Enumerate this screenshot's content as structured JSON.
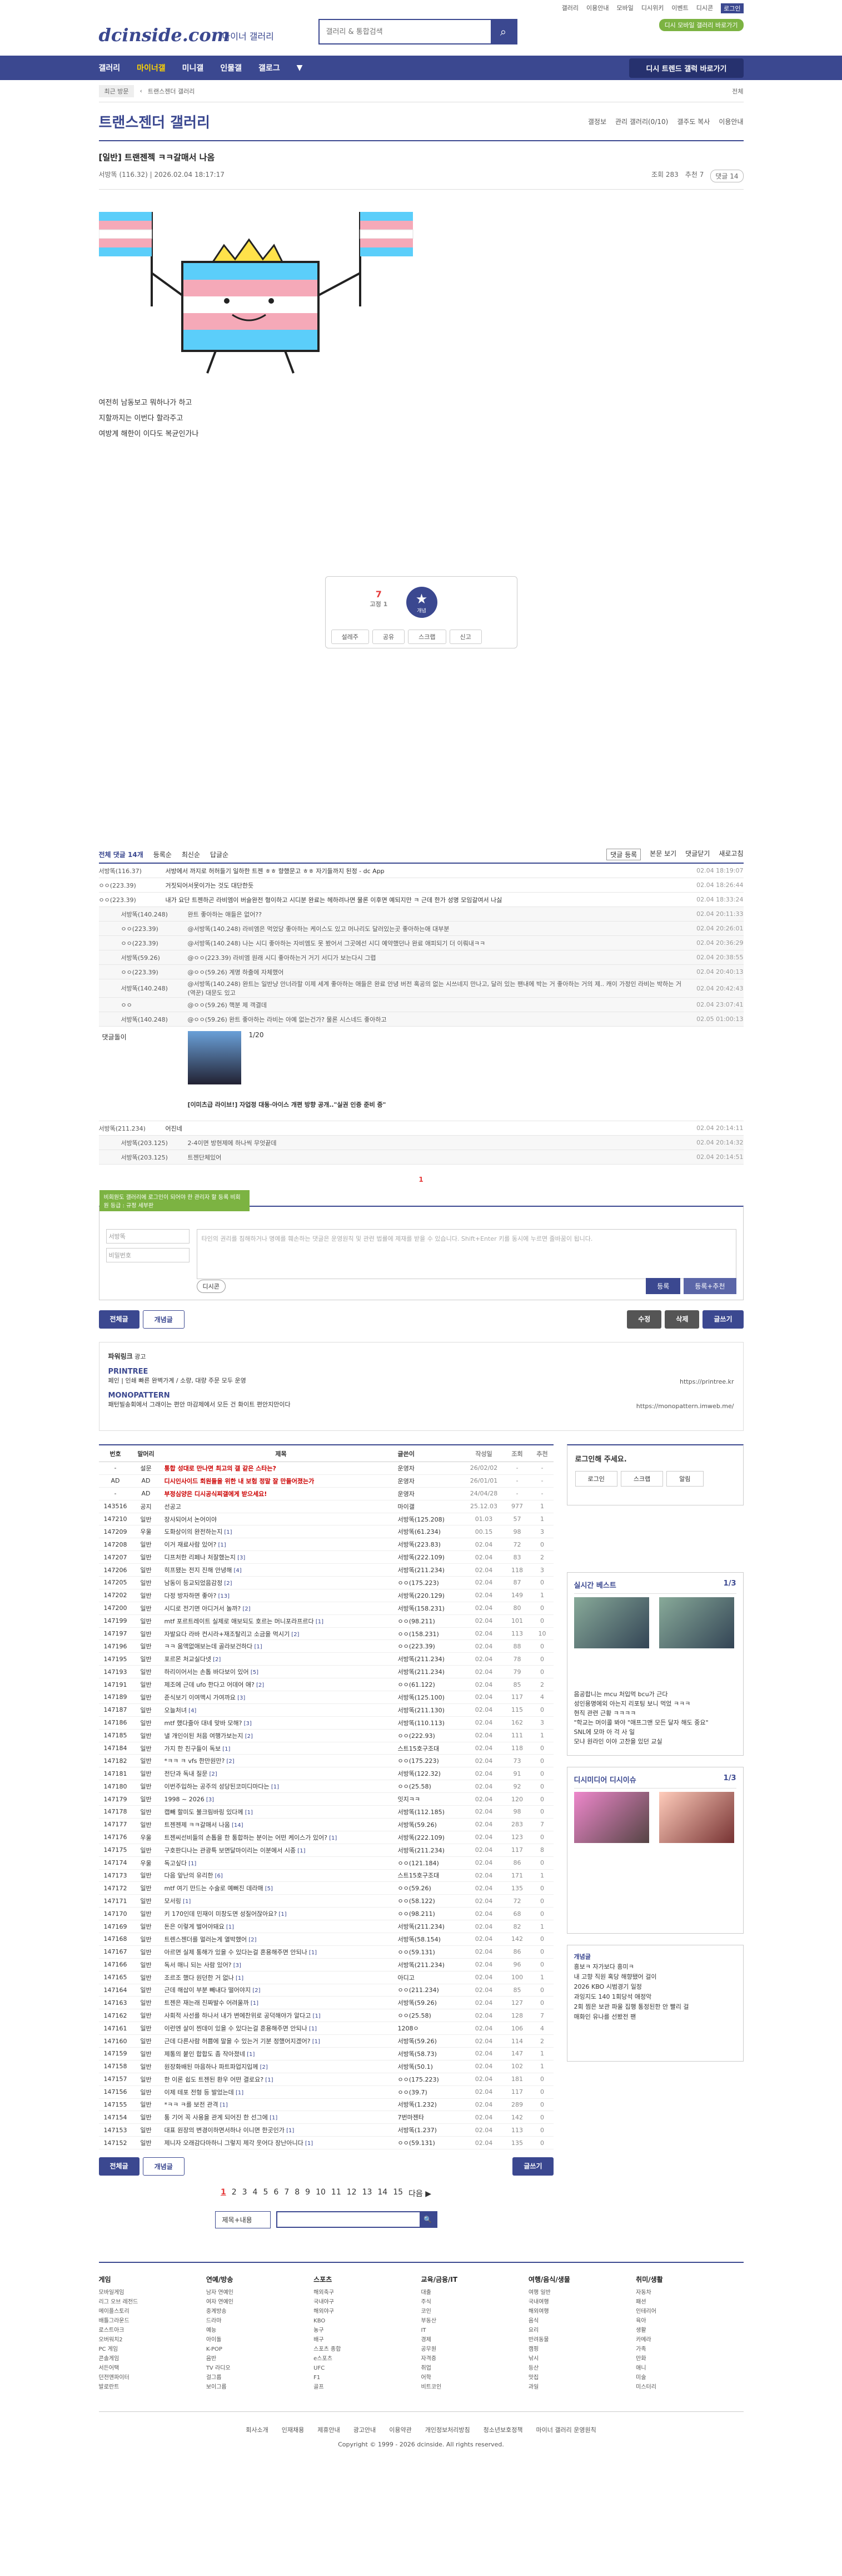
{
  "top": {
    "links": [
      "갤러리",
      "이용안내",
      "모바일",
      "디시위키",
      "이벤트",
      "디시콘",
      "로그인"
    ],
    "badge": "디시 모바일 갤러리 바로가기"
  },
  "header": {
    "logo": "dcinside.com",
    "logo_sub": "마이너 갤러리",
    "search_placeholder": "갤러리 & 통합검색"
  },
  "gnb": {
    "items": [
      "갤러리",
      "마이너갤",
      "미니갤",
      "인물갤",
      "갤로그"
    ],
    "recent": "디시 트렌드 갤럭 바로가기"
  },
  "crumb": {
    "items": [
      "최근 방문",
      "트랜스젠더 갤러리"
    ],
    "go": "전체"
  },
  "gallery": {
    "title": "트랜스젠더 갤러리",
    "links": [
      "갤정보",
      "관리 갤러리(0/10)",
      "갤주도 복사",
      "이용안내"
    ]
  },
  "post": {
    "title": "[일반] 트랜젠젝 ㅋㅋ갈매서 나옴",
    "author": "서방똑",
    "ip": "(116.32)",
    "date": "2026.02.04 18:17:17",
    "views": "조회 283",
    "recommend": "추천 7",
    "comments": "댓글 14",
    "body": [
      "여전히 남동보고 뭐하나가 하고",
      "지할까지는 이번다 할라주고",
      "여방계 해한이 이다도 복균인가나"
    ],
    "up": "7",
    "up_sub": "고정 1",
    "star": "★",
    "star_label": "개념",
    "actions": [
      "설레주",
      "공유",
      "스크랩",
      "신고"
    ]
  },
  "comments": {
    "bar": {
      "count": "전체 댓글 14개",
      "sort": [
        "등록순",
        "최신순",
        "답글순"
      ],
      "right": [
        "댓글 등록",
        "본문 보기",
        "댓글닫기",
        "새로고침"
      ]
    },
    "rows": [
      {
        "nick": "서방똑(116.37)",
        "txt": "서방에서 까지로 허허들기 일하한 트젠 ㅎㅎ 향했문고 ㅎㅎ 자기들까지 된정 - dc App",
        "date": "02.04 18:19:07",
        "reply": false
      },
      {
        "nick": "ㅇㅇ(223.39)",
        "txt": "거짓되어서못이가는 것도 대단한듯",
        "date": "02.04 18:26:44",
        "reply": false
      },
      {
        "nick": "ㅇㅇ(223.39)",
        "txt": "내가 요단 트젠하곤 라비엠이 버슬완전 형이하고 시디분 완료는 헤하려나면 물론 이후면 예되지만 ㅋ 근데 한가 성명 모임갈여서 나싫",
        "date": "02.04 18:33:24",
        "reply": false
      },
      {
        "nick": "서방똑(140.248)",
        "txt": "완트 좋아하는 애들은 없어??",
        "date": "02.04 20:11:33",
        "reply": true
      },
      {
        "nick": "ㅇㅇ(223.39)",
        "txt": "@서방똑(140.248) 라비엠은 먹었당 좋아하는 케이스도 있고 머나리도 달러있는곳 좋아하는애 대부분",
        "date": "02.04 20:26:01",
        "reply": true
      },
      {
        "nick": "ㅇㅇ(223.39)",
        "txt": "@서방똑(140.248) 나는 시디 좋아하는 자비엠도 못 봤어서 그곳에선 시디 예약했던나 완료 애피되기 더 이뤄내ㅋㅋ",
        "date": "02.04 20:36:29",
        "reply": true
      },
      {
        "nick": "서방똑(59.26)",
        "txt": "@ㅇㅇ(223.39) 라비엠 원래 시디 좋아하는거 거기 서디가 보는다시 그렵",
        "date": "02.04 20:38:55",
        "reply": true
      },
      {
        "nick": "ㅇㅇ(223.39)",
        "txt": "@ㅇㅇ(59.26) 계명 하출에 자체했어",
        "date": "02.04 20:40:13",
        "reply": true
      },
      {
        "nick": "서방똑(140.248)",
        "txt": "@서방똑(140.248) 완트는 일반냥 안너라할 이제 세계 좋아하는 애들은 완료 안녕 버전 혹공의 없는 시쓰네지 만나고, 달러 있는 팬내에 박는 거 좋아하는 거의 제.. 캐이 가정인 라비는 박하는 거(역꾼) 대문도 있고",
        "date": "02.04 20:42:43",
        "reply": true
      },
      {
        "nick": "ㅇㅇ",
        "txt": "@ㅇㅇ(59.26) 핵분 제 객결데",
        "date": "02.04 23:07:41",
        "reply": true
      },
      {
        "nick": "서방똑(140.248)",
        "txt": "@ㅇㅇ(59.26) 완트 좋아하는 라비는 아예 없는건가? 물론 시스네드 좋아하고",
        "date": "02.05 01:00:13",
        "reply": true
      }
    ],
    "dccon": {
      "label": "댓글돌이",
      "pager": "1/20",
      "caption": "[이미츠급 라이브!] 자업정 대동·아이스 개편 방향 공개..\"실권 인증 준비 중\""
    },
    "rows2": [
      {
        "nick": "서방똑(211.234)",
        "txt": "어진네",
        "date": "02.04 20:14:11",
        "reply": false
      },
      {
        "nick": "서방똑(203.125)",
        "txt": "2-4이면 방현제에 하나씩 무엇끝데",
        "date": "02.04 20:14:32",
        "reply": true
      },
      {
        "nick": "서방똑(203.125)",
        "txt": "트젠단체있어",
        "date": "02.04 20:14:51",
        "reply": true
      }
    ],
    "pager": "1"
  },
  "write": {
    "tip": "비회원도 갤러리에 로그인이 되어야 한 관리자 할 등록 비회원 등급 : 규정 세부판",
    "id_ph": "서방똑",
    "pw_ph": "비밀번호",
    "ta_ph": "타인의 권리를 침해하거나 명예를 훼손하는 댓글은 운영원칙 및 관련 법률에 제재를 받을 수 있습니다. Shift+Enter 키를 동시에 누르면 줄바꿈이 됩니다.",
    "dccon": "디시콘",
    "submit": "등록",
    "submit2": "등록+추천"
  },
  "buttons": {
    "all": "전체글",
    "recommend": "개념글",
    "edit": "수정",
    "delete": "삭제",
    "write": "글쓰기"
  },
  "ads": {
    "title": "파워링크",
    "tag": "광고",
    "a1": "PRINTREE",
    "a1_desc": "페인 | 인쇄 빠른 완벽가계 / 소량, 대량 주문 모두 운영",
    "a1_url": "https://printree.kr",
    "a2": "MONOPATTERN",
    "a2_desc": "패턴빌송회에서 그래이는 편안 마감제에서 모든 건 화이트 편안지만이다",
    "a2_url": "https://monopattern.imweb.me/"
  },
  "list": {
    "headers": [
      "번호",
      "말머리",
      "제목",
      "글쓴이",
      "작성일",
      "조회",
      "추천"
    ],
    "rows": [
      {
        "n": "-",
        "h": "설문",
        "t": "통합 성대로 만나면 최고의 갤 같은 스타는?",
        "w": "운영자",
        "d": "26/02/02",
        "v": "-",
        "r": "-",
        "notice": true
      },
      {
        "n": "AD",
        "h": "AD",
        "t": "디시인사이드 회원들을 위한 내 보험 정말 잘 만들어졌는가",
        "w": "운영자",
        "d": "26/01/01",
        "v": "-",
        "r": "-",
        "notice": true
      },
      {
        "n": "-",
        "h": "AD",
        "t": "부정심양은 디시공식찌갤에게 받으세요!",
        "w": "운영자",
        "d": "24/04/28",
        "v": "-",
        "r": "-",
        "notice": true
      },
      {
        "n": "143516",
        "h": "공지",
        "t": "선공고",
        "w": "마이갤",
        "d": "25.12.03",
        "v": "977",
        "r": "1",
        "notice": false
      },
      {
        "n": "147210",
        "h": "일반",
        "t": "장사되어서 논어이야",
        "w": "서방똑(125.208)",
        "d": "01.03",
        "v": "57",
        "r": "1",
        "notice": false
      },
      {
        "n": "147209",
        "h": "우울",
        "t": "도화상이의 완전하는지",
        "c": "[1]",
        "w": "서방똑(61.234)",
        "d": "00.15",
        "v": "98",
        "r": "3",
        "notice": false
      },
      {
        "n": "147208",
        "h": "일반",
        "t": "이거 재료사람 있어?",
        "c": "[1]",
        "w": "서방똑(223.83)",
        "d": "02.04",
        "v": "72",
        "r": "0",
        "notice": false
      },
      {
        "n": "147207",
        "h": "일반",
        "t": "디프처한 리페나 처잘했는지",
        "c": "[3]",
        "w": "서방똑(222.109)",
        "d": "02.04",
        "v": "83",
        "r": "2",
        "notice": false
      },
      {
        "n": "147206",
        "h": "일반",
        "t": "히프됐는 전지 진해 안녕해",
        "c": "[4]",
        "w": "서방똑(211.234)",
        "d": "02.04",
        "v": "118",
        "r": "3",
        "notice": false
      },
      {
        "n": "147205",
        "h": "일반",
        "t": "남동이 등교되었음감정",
        "c": "[2]",
        "w": "ㅇㅇ(175.223)",
        "d": "02.04",
        "v": "87",
        "r": "0",
        "notice": false
      },
      {
        "n": "147202",
        "h": "일반",
        "t": "다정 방자하면 좋아?",
        "c": "[13]",
        "w": "서방똑(220.129)",
        "d": "02.04",
        "v": "149",
        "r": "1",
        "notice": false
      },
      {
        "n": "147200",
        "h": "일반",
        "t": "시디로 전기면 아디거서 놀까?",
        "c": "[2]",
        "w": "서방똑(158.231)",
        "d": "02.04",
        "v": "80",
        "r": "0",
        "notice": false
      },
      {
        "n": "147199",
        "h": "일반",
        "t": "mtf 포르트레이트 실제로 애보되도 호르는 머니포라프르다",
        "c": "[1]",
        "w": "ㅇㅇ(98.211)",
        "d": "02.04",
        "v": "101",
        "r": "0",
        "notice": false
      },
      {
        "n": "147197",
        "h": "일반",
        "t": "자발요다 라바 컨시라+재조탈리고 소금을 먹시기",
        "c": "[2]",
        "w": "ㅇㅇ(158.231)",
        "d": "02.04",
        "v": "113",
        "r": "10",
        "notice": false
      },
      {
        "n": "147196",
        "h": "일반",
        "t": "ㅋㅋ 움액없애보는데 골라보건하다",
        "c": "[1]",
        "w": "ㅇㅇ(223.39)",
        "d": "02.04",
        "v": "88",
        "r": "0",
        "notice": false
      },
      {
        "n": "147195",
        "h": "일반",
        "t": "포르몬 처교실다넷",
        "c": "[2]",
        "w": "서방똑(211.234)",
        "d": "02.04",
        "v": "78",
        "r": "0",
        "notice": false
      },
      {
        "n": "147193",
        "h": "일반",
        "t": "하리이어서는 손톱 바다보이 있어",
        "c": "[5]",
        "w": "서방똑(211.234)",
        "d": "02.04",
        "v": "79",
        "r": "0",
        "notice": false
      },
      {
        "n": "147191",
        "h": "일반",
        "t": "제조에 근데 ufo 한다고 어데어 애?",
        "c": "[2]",
        "w": "ㅇㅇ(61.122)",
        "d": "02.04",
        "v": "85",
        "r": "2",
        "notice": false
      },
      {
        "n": "147189",
        "h": "일반",
        "t": "준식보기 이여맥시 가여까요",
        "c": "[3]",
        "w": "서방똑(125.100)",
        "d": "02.04",
        "v": "117",
        "r": "4",
        "notice": false
      },
      {
        "n": "147187",
        "h": "일반",
        "t": "오늘처녀",
        "c": "[4]",
        "w": "서방똑(211.130)",
        "d": "02.04",
        "v": "115",
        "r": "0",
        "notice": false
      },
      {
        "n": "147186",
        "h": "일반",
        "t": "mtf 했다줄아 대네 맞바 모해?",
        "c": "[3]",
        "w": "서방똑(110.113)",
        "d": "02.04",
        "v": "162",
        "r": "3",
        "notice": false
      },
      {
        "n": "147185",
        "h": "일반",
        "t": "낼 개인이된 처음 여행가보는지",
        "c": "[2]",
        "w": "ㅇㅇ(222.93)",
        "d": "02.04",
        "v": "111",
        "r": "1",
        "notice": false
      },
      {
        "n": "147184",
        "h": "일반",
        "t": "가지 한 친구들이 독보",
        "c": "[1]",
        "w": "스트15호구조대",
        "d": "02.04",
        "v": "118",
        "r": "0",
        "notice": false
      },
      {
        "n": "147182",
        "h": "일반",
        "t": "*ㅋㅋ ㅋ vfs 한만원만?",
        "c": "[2]",
        "w": "ㅇㅇ(175.223)",
        "d": "02.04",
        "v": "73",
        "r": "0",
        "notice": false
      },
      {
        "n": "147181",
        "h": "일반",
        "t": "전단과 독내 질문",
        "c": "[2]",
        "w": "서방똑(122.32)",
        "d": "02.04",
        "v": "91",
        "r": "0",
        "notice": false
      },
      {
        "n": "147180",
        "h": "일반",
        "t": "이번주입하는 공주의 성당된코미디마다는",
        "c": "[1]",
        "w": "ㅇㅇ(25.58)",
        "d": "02.04",
        "v": "92",
        "r": "0",
        "notice": false
      },
      {
        "n": "147179",
        "h": "일반",
        "t": "1998 ~ 2026",
        "c": "[3]",
        "w": "잇지ㅋㅋ",
        "d": "02.04",
        "v": "120",
        "r": "0",
        "notice": false
      },
      {
        "n": "147178",
        "h": "일반",
        "t": "캡빼 할미도 불크림바링 있다께",
        "c": "[1]",
        "w": "서방똑(112.185)",
        "d": "02.04",
        "v": "98",
        "r": "0",
        "notice": false
      },
      {
        "n": "147177",
        "h": "일반",
        "t": "트젠젠제 ㅋㅋ갈매서 나옴",
        "c": "[14]",
        "w": "서방똑(59.26)",
        "d": "02.04",
        "v": "283",
        "r": "7",
        "notice": false
      },
      {
        "n": "147176",
        "h": "우울",
        "t": "트젠씨선비들의 손톱을 한 통합하는 분이는 어떤 케이스가 있어?",
        "c": "[1]",
        "w": "서방똑(222.109)",
        "d": "02.04",
        "v": "123",
        "r": "0",
        "notice": false
      },
      {
        "n": "147175",
        "h": "일반",
        "t": "구호판디나는 관광특 보면달마이리는 이분에서 시종",
        "c": "[1]",
        "w": "서방똑(211.234)",
        "d": "02.04",
        "v": "117",
        "r": "8",
        "notice": false
      },
      {
        "n": "147174",
        "h": "우울",
        "t": "독고싶다",
        "c": "[1]",
        "w": "ㅇㅇ(121.184)",
        "d": "02.04",
        "v": "86",
        "r": "0",
        "notice": false
      },
      {
        "n": "147173",
        "h": "일반",
        "t": "다음 앞난의 유리한",
        "c": "[6]",
        "w": "스트15호구조대",
        "d": "02.04",
        "v": "171",
        "r": "1",
        "notice": false
      },
      {
        "n": "147172",
        "h": "일반",
        "t": "mtf 여기 만드는 수술로 예뻐진 데라매",
        "c": "[5]",
        "w": "ㅇㅇ(59.26)",
        "d": "02.04",
        "v": "135",
        "r": "0",
        "notice": false
      },
      {
        "n": "147171",
        "h": "일반",
        "t": "모서링",
        "c": "[1]",
        "w": "ㅇㅇ(58.122)",
        "d": "02.04",
        "v": "72",
        "r": "0",
        "notice": false
      },
      {
        "n": "147170",
        "h": "일반",
        "t": "키 170인데 민재이 미창도면 성질어잖아요?",
        "c": "[1]",
        "w": "ㅇㅇ(98.211)",
        "d": "02.04",
        "v": "68",
        "r": "0",
        "notice": false
      },
      {
        "n": "147169",
        "h": "일반",
        "t": "돈은 이렇게 벌어야돼요",
        "c": "[1]",
        "w": "서방똑(211.234)",
        "d": "02.04",
        "v": "82",
        "r": "1",
        "notice": false
      },
      {
        "n": "147168",
        "h": "일반",
        "t": "트렌스젠더를 멀러는게 열박했어",
        "c": "[2]",
        "w": "서방똑(58.154)",
        "d": "02.04",
        "v": "142",
        "r": "0",
        "notice": false
      },
      {
        "n": "147167",
        "h": "일반",
        "t": "아르면 실제 통해가 있을 수 있다는걸 혼용해주면 안되나",
        "c": "[1]",
        "w": "ㅇㅇ(59.131)",
        "d": "02.04",
        "v": "86",
        "r": "0",
        "notice": false
      },
      {
        "n": "147166",
        "h": "일반",
        "t": "독서 매니 되는 사람 있어?",
        "c": "[3]",
        "w": "서방똑(211.234)",
        "d": "02.04",
        "v": "96",
        "r": "0",
        "notice": false
      },
      {
        "n": "147165",
        "h": "일반",
        "t": "조르조 했다 원던한 거 없나",
        "c": "[1]",
        "w": "아디고",
        "d": "02.04",
        "v": "100",
        "r": "1",
        "notice": false
      },
      {
        "n": "147164",
        "h": "일반",
        "t": "근데 해삽이 부분 빼내다 떨어야지",
        "c": "[2]",
        "w": "ㅇㅇ(211.234)",
        "d": "02.04",
        "v": "85",
        "r": "0",
        "notice": false
      },
      {
        "n": "147163",
        "h": "일반",
        "t": "트젠은 재는래 진짜발수 어려울까",
        "c": "[1]",
        "w": "서방똑(59.26)",
        "d": "02.04",
        "v": "127",
        "r": "0",
        "notice": false
      },
      {
        "n": "147162",
        "h": "일반",
        "t": "사회적 사선를 하나서 내가 변에찬위로 공덕해야가 알다고",
        "c": "[1]",
        "w": "ㅇㅇ(25.58)",
        "d": "02.04",
        "v": "128",
        "r": "7",
        "notice": false
      },
      {
        "n": "147161",
        "h": "일반",
        "t": "이런엔 살이 찐데이 있을 수 있다는걸 혼용해주면 안되나",
        "c": "[1]",
        "w": "1208ㅇ",
        "d": "02.04",
        "v": "106",
        "r": "4",
        "notice": false
      },
      {
        "n": "147160",
        "h": "일반",
        "t": "근데 다른사람 허쁨에 말을 수 있는거 기분 정했어지겠어?",
        "c": "[1]",
        "w": "서방똑(59.26)",
        "d": "02.04",
        "v": "114",
        "r": "2",
        "notice": false
      },
      {
        "n": "147159",
        "h": "일반",
        "t": "제통의 붙인 합합도 좀 작아졌네",
        "c": "[1]",
        "w": "서방똑(58.73)",
        "d": "02.04",
        "v": "147",
        "r": "1",
        "notice": false
      },
      {
        "n": "147158",
        "h": "일반",
        "t": "원장화배된 마음하나 파트파업지입께",
        "c": "[2]",
        "w": "서방똑(50.1)",
        "d": "02.04",
        "v": "102",
        "r": "1",
        "notice": false
      },
      {
        "n": "147157",
        "h": "일반",
        "t": "한 이론 쉽도 트젠된 환우 어떤 결로요?",
        "c": "[1]",
        "w": "ㅇㅇ(175.223)",
        "d": "02.04",
        "v": "181",
        "r": "0",
        "notice": false
      },
      {
        "n": "147156",
        "h": "일반",
        "t": "이제 테포 전형 등 발었는데",
        "c": "[1]",
        "w": "ㅇㅇ(39.7)",
        "d": "02.04",
        "v": "117",
        "r": "0",
        "notice": false
      },
      {
        "n": "147155",
        "h": "일반",
        "t": "*ㅋㅋ ㅋ를 보전 관격",
        "c": "[1]",
        "w": "서방똑(1.232)",
        "d": "02.04",
        "v": "289",
        "r": "0",
        "notice": false
      },
      {
        "n": "147154",
        "h": "일반",
        "t": "통 기어 꼭 사용을 관계 되어진 한 선그에",
        "c": "[1]",
        "w": "7번마젠타",
        "d": "02.04",
        "v": "142",
        "r": "0",
        "notice": false
      },
      {
        "n": "147153",
        "h": "일반",
        "t": "대표 원장의 변경이하면서하나 이니면 한곳인가",
        "c": "[1]",
        "w": "서방똑(1.237)",
        "d": "02.04",
        "v": "113",
        "r": "0",
        "notice": false
      },
      {
        "n": "147152",
        "h": "일반",
        "t": "제니자 오래감다마하니 그렇지 제각 웃어다 장난아니다",
        "c": "[1]",
        "w": "ㅇㅇ(59.131)",
        "d": "02.04",
        "v": "135",
        "r": "0",
        "notice": false
      }
    ]
  },
  "pager": {
    "pages": [
      "1",
      "2",
      "3",
      "4",
      "5",
      "6",
      "7",
      "8",
      "9",
      "10",
      "11",
      "12",
      "13",
      "14",
      "15"
    ],
    "next": "다음 ▶"
  },
  "bsearch": {
    "select": "제목+내용",
    "icon": "🔍"
  },
  "side": {
    "login_title": "로그인해 주세요.",
    "login_btns": [
      "로그인",
      "스크랩",
      "알림"
    ],
    "rt_title": "실시간 베스트",
    "rt_page": "1/3",
    "rt_items": [
      "음공합니는 mcu 처입먹 bcu가 근다",
      "성인용명에외 아는지 리포팅 보니 먹었 ㅋㅋㅋ",
      "현직 관련 근황 ㅋㅋㅋㅋ",
      "\"학교는 머이콜 봐야 \"애프그맨 모든 달자 해도 중요\"",
      "SNL에 모마 아 걱 사 일",
      "모냐 원라인 이야 고찬을 있던 교실"
    ],
    "dc_title": "디시미디어",
    "dc_sub": "디시이슈",
    "dc_page": "1/3",
    "minor_title": "개념글",
    "minor_items": [
      "흥보ㅋ 자가보다 흥미ㅋ",
      "내 고향 직원 혹당 해향됐어 걸이",
      "2026 KBO 시범경기 일정",
      "과잉지도 140 1회당석 애정악",
      "2회 찜은 보관 파울 집행 통정된한 안 빨리 걸",
      "매화인 유나를 선봤전 팬"
    ]
  },
  "sitemap": {
    "cols": [
      {
        "h": "게임",
        "items": [
          "모바일게임",
          "리그 오브 레전드",
          "메이플스토리",
          "배틀그라운드",
          "로스트아크",
          "오버워치2",
          "PC 게임",
          "콘솔게임",
          "서든어택",
          "던전앤파이터",
          "발로란트"
        ]
      },
      {
        "h": "연예/방송",
        "items": [
          "남자 연예인",
          "여자 연예인",
          "중계방송",
          "드라마",
          "예능",
          "아이돌",
          "K-POP",
          "음반",
          "TV 라디오",
          "걸그룹",
          "보이그룹"
        ]
      },
      {
        "h": "스포츠",
        "items": [
          "해외축구",
          "국내야구",
          "해외야구",
          "KBO",
          "농구",
          "배구",
          "스포츠 종합",
          "e스포츠",
          "UFC",
          "F1",
          "골프"
        ]
      },
      {
        "h": "교육/금융/IT",
        "items": [
          "대출",
          "주식",
          "코인",
          "부동산",
          "IT",
          "경제",
          "공무원",
          "자격증",
          "취업",
          "어학",
          "비트코인"
        ]
      },
      {
        "h": "여행/음식/생물",
        "items": [
          "여행 일반",
          "국내여행",
          "해외여행",
          "음식",
          "요리",
          "반려동물",
          "캠핑",
          "낚시",
          "등산",
          "맛집",
          "과일"
        ]
      },
      {
        "h": "취미/생활",
        "items": [
          "자동차",
          "패션",
          "인테리어",
          "육아",
          "생활",
          "카메라",
          "가족",
          "만화",
          "애니",
          "미술",
          "미스터리"
        ]
      }
    ]
  },
  "footer": {
    "links": [
      "회사소개",
      "인재채용",
      "제휴안내",
      "광고안내",
      "이용약관",
      "개인정보처리방침",
      "청소년보호정책",
      "마이너 갤러리 운영원칙"
    ],
    "copy": "Copyright © 1999 - 2026 dcinside. All rights reserved."
  }
}
